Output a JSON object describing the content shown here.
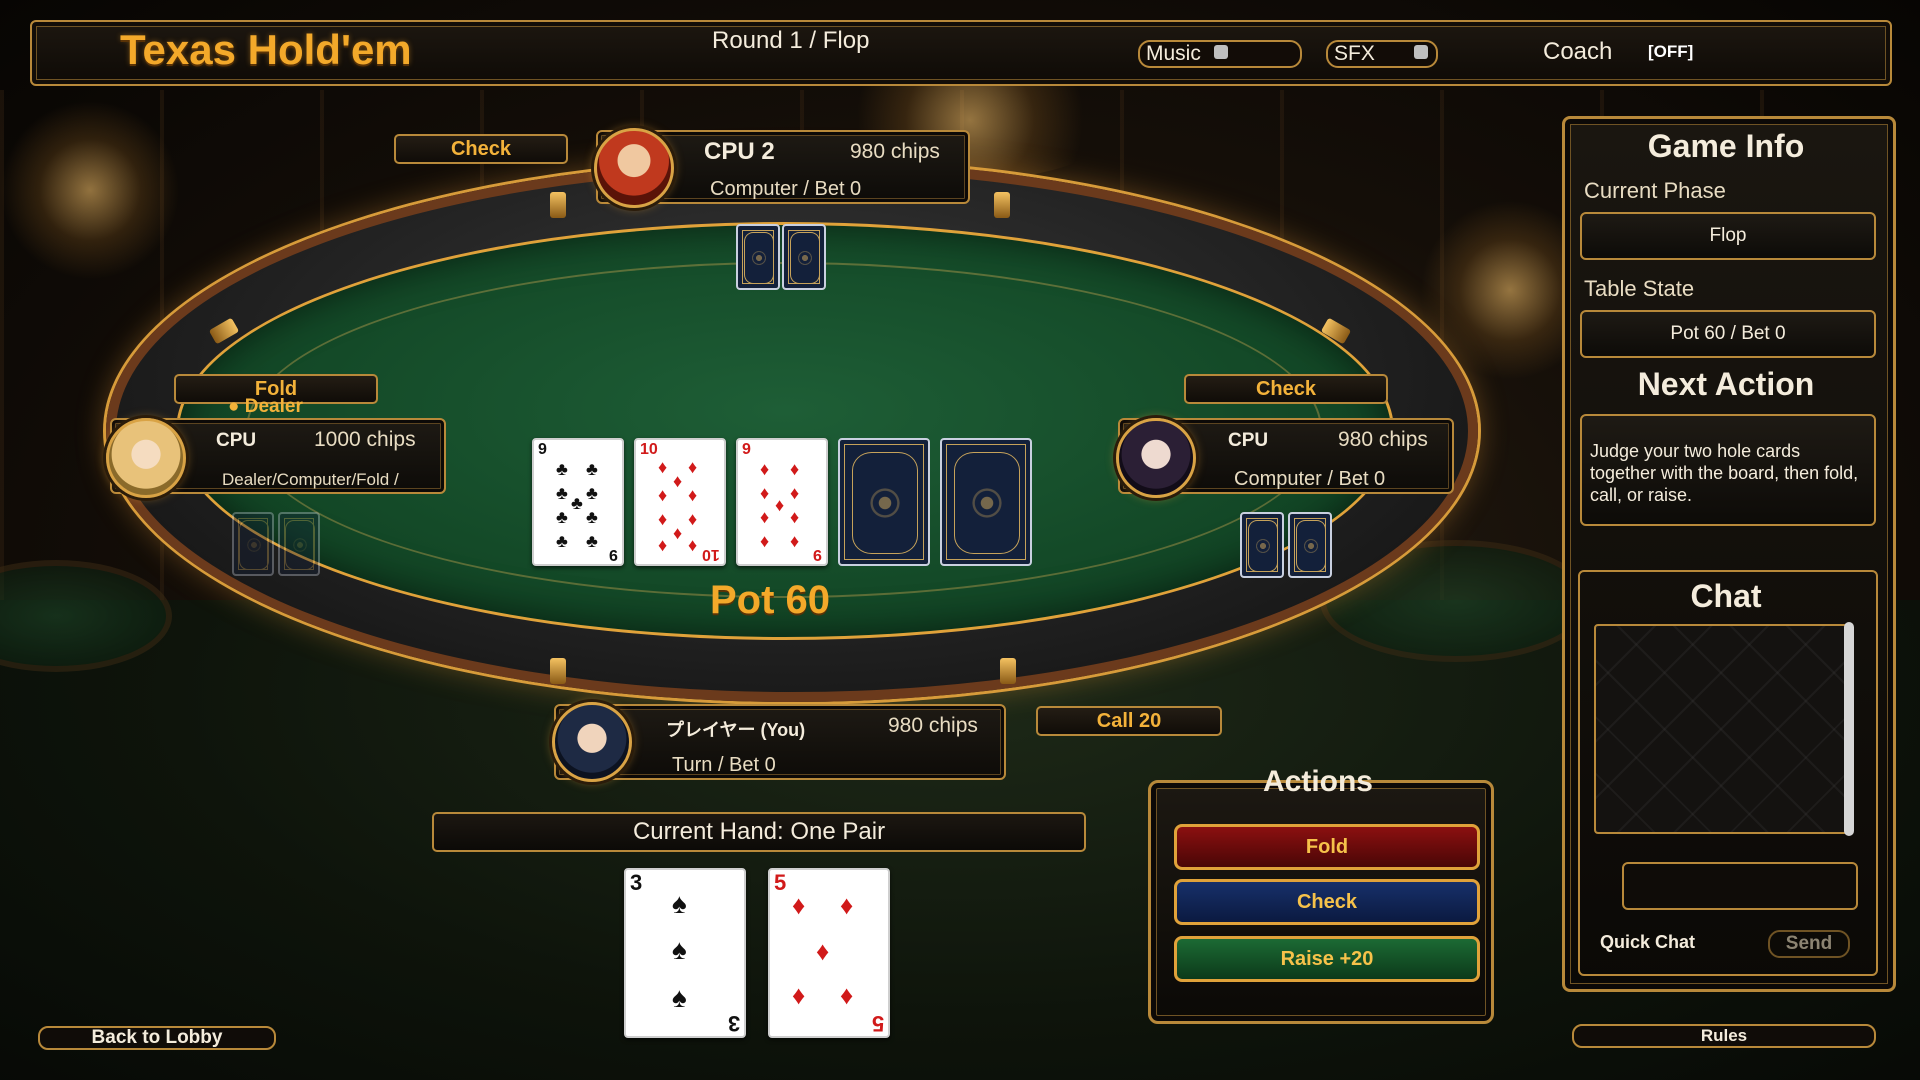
{
  "header": {
    "title": "Texas Hold'em",
    "round": "Round 1 / Flop",
    "music_label": "Music",
    "sfx_label": "SFX",
    "coach_label": "Coach",
    "coach_state": "[OFF]"
  },
  "players": {
    "cpu2": {
      "action": "Check",
      "name": "CPU 2",
      "chips": "980 chips",
      "status": "Computer / Bet 0"
    },
    "cpu_left": {
      "action": "Fold",
      "dealer": "Dealer",
      "name": "CPU",
      "chips": "1000 chips",
      "status": "Dealer/Computer/Fold /"
    },
    "cpu_right": {
      "action": "Check",
      "name": "CPU",
      "chips": "980 chips",
      "status": "Computer / Bet 0"
    },
    "you": {
      "action": "Call 20",
      "name": "プレイヤー (You)",
      "chips": "980 chips",
      "status": "Turn / Bet 0"
    }
  },
  "board": [
    {
      "rank": "9",
      "suit": "♣",
      "color": "black"
    },
    {
      "rank": "10",
      "suit": "♦",
      "color": "red"
    },
    {
      "rank": "9",
      "suit": "♦",
      "color": "red"
    },
    {
      "face_down": true
    },
    {
      "face_down": true
    }
  ],
  "pot": "Pot 60",
  "current_hand": "Current Hand: One Pair",
  "hole_cards": [
    {
      "rank": "3",
      "suit": "♠",
      "color": "black"
    },
    {
      "rank": "5",
      "suit": "♦",
      "color": "red"
    }
  ],
  "actions": {
    "title": "Actions",
    "fold": "Fold",
    "check": "Check",
    "raise": "Raise +20"
  },
  "game_info": {
    "title": "Game Info",
    "phase_label": "Current Phase",
    "phase_value": "Flop",
    "table_label": "Table State",
    "table_value": "Pot 60 / Bet 0",
    "next_title": "Next Action",
    "next_text": "Judge your two hole cards together with the board, then fold, call, or raise."
  },
  "chat": {
    "title": "Chat",
    "quick_chat": "Quick Chat",
    "send": "Send"
  },
  "footer": {
    "back": "Back to Lobby",
    "rules": "Rules"
  },
  "colors": {
    "gold": "#f3a92a",
    "felt": "#1e5e36",
    "fold": "#8b1010",
    "check": "#17306a",
    "raise": "#1c6a34"
  }
}
